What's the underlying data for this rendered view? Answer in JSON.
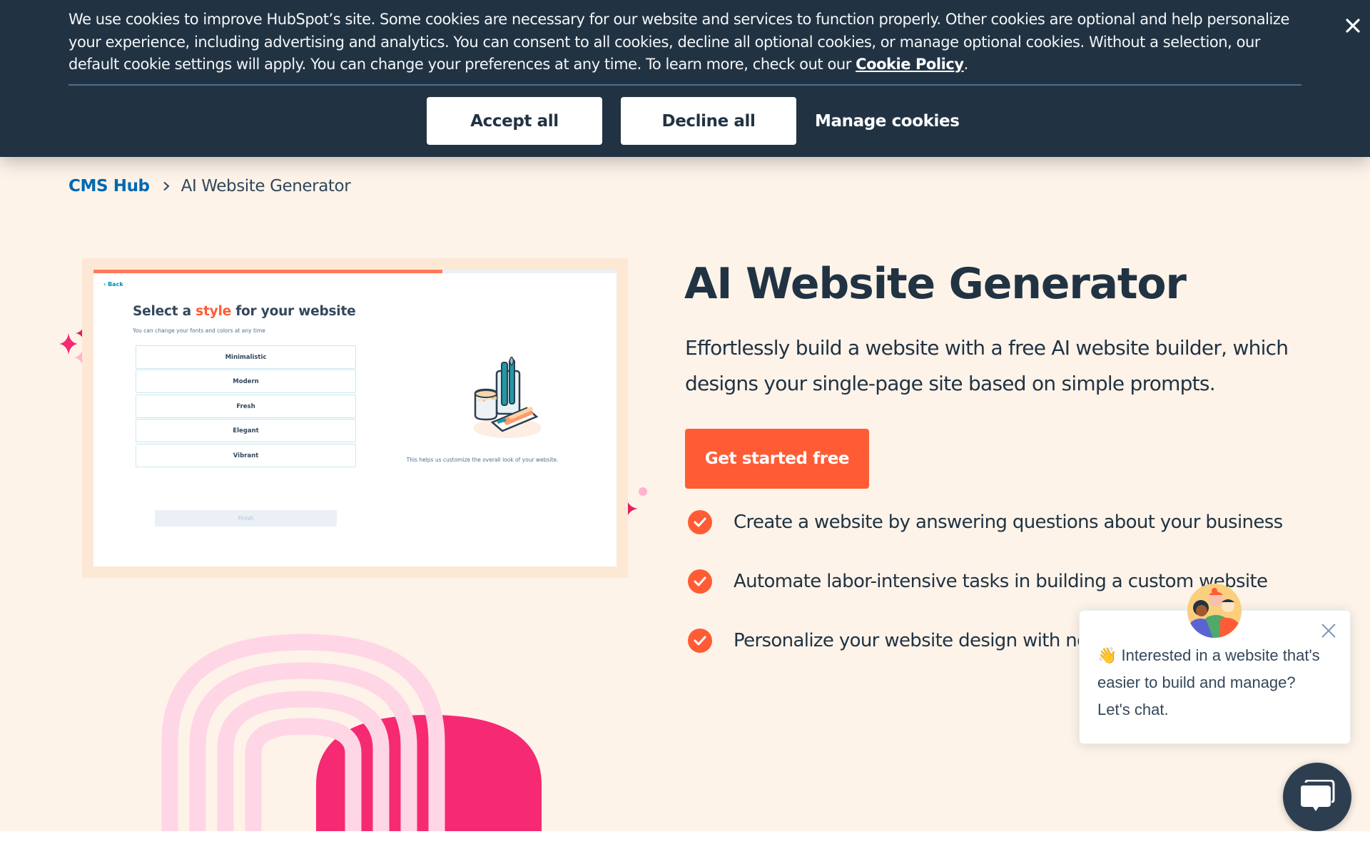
{
  "cookie_banner": {
    "text": "We use cookies to improve HubSpot’s site. Some cookies are necessary for our website and services to function properly. Other cookies are optional and help personalize your experience, including advertising and analytics. You can consent to all cookies, decline all optional cookies, or manage optional cookies. Without a selection, our default cookie settings will apply. You can change your preferences at any time. To learn more, check out our ",
    "policy_link": "Cookie Policy",
    "policy_suffix": ".",
    "accept_label": "Accept all",
    "decline_label": "Decline all",
    "manage_label": "Manage cookies",
    "close_icon": "close-icon"
  },
  "breadcrumb": {
    "parent": "CMS Hub",
    "separator_icon": "chevron-right-icon",
    "current": "AI Website Generator"
  },
  "mockup": {
    "back_label": "‹ Back",
    "progress": 0.667,
    "title_prefix": "Select a ",
    "title_accent": "style",
    "title_suffix": " for your website",
    "subtitle": "You can change your fonts and colors at any time",
    "options": [
      "Minimalistic",
      "Modern",
      "Fresh",
      "Elegant",
      "Vibrant"
    ],
    "finish_label": "Finish",
    "help_text": "This helps us customize the overall look of your website.",
    "illustration": "paint-supplies-illustration"
  },
  "hero": {
    "title": "AI Website Generator",
    "description": "Effortlessly build a website with a free AI website builder, which designs your single-page site based on simple prompts.",
    "cta_label": "Get started free",
    "features": [
      "Create a website by answering questions about your business",
      "Automate labor-intensive tasks in building a custom website",
      "Personalize your website design with no-code tools"
    ]
  },
  "chat": {
    "message": "👋 Interested in a website that's easier to build and manage? Let's chat.",
    "close_icon": "close-icon",
    "launcher_icon": "chat-bubble-icon",
    "avatar": "team-avatar"
  },
  "colors": {
    "banner_bg": "#213343",
    "page_bg": "#fdf3e9",
    "accent_orange": "#ff5c35",
    "link_blue": "#0068b1",
    "magenta": "#f52a72",
    "light_pink": "#ffd6e6",
    "chat_launcher": "#2d3e50"
  }
}
